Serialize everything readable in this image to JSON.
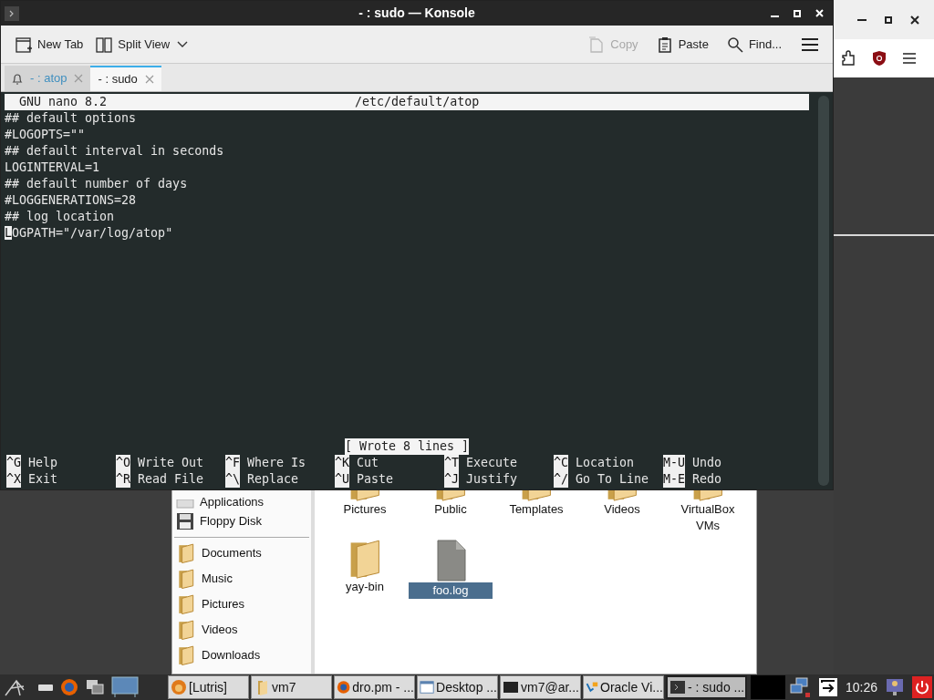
{
  "konsole": {
    "title": "- : sudo — Konsole",
    "toolbar_left": [
      {
        "label": "New Tab",
        "kind": "new-tab",
        "disabled": false
      },
      {
        "label": "Split View",
        "kind": "split-view",
        "disabled": false
      }
    ],
    "toolbar_right": [
      {
        "label": "Copy",
        "kind": "copy",
        "disabled": true
      },
      {
        "label": "Paste",
        "kind": "paste",
        "disabled": false
      },
      {
        "label": "Find...",
        "kind": "find",
        "disabled": false
      }
    ],
    "tabs": [
      {
        "label": "- : atop",
        "selected": false,
        "bell": true
      },
      {
        "label": "- : sudo",
        "selected": true,
        "bell": false
      }
    ],
    "nano": {
      "version": "GNU nano 8.2",
      "file": "/etc/default/atop",
      "lines": [
        {
          "text": "## default options",
          "cursor": false
        },
        {
          "text": "#LOGOPTS=\"\"",
          "cursor": false
        },
        {
          "text": "## default interval in seconds",
          "cursor": false
        },
        {
          "text": "LOGINTERVAL=1",
          "cursor": false
        },
        {
          "text": "## default number of days",
          "cursor": false
        },
        {
          "text": "#LOGGENERATIONS=28",
          "cursor": false
        },
        {
          "text": "## log location",
          "cursor": false
        },
        {
          "text": "LOGPATH=\"/var/log/atop\"",
          "cursor": true
        }
      ],
      "status": "[ Wrote 8 lines ]",
      "shortcuts": [
        [
          {
            "key": "^G",
            "label": "Help"
          },
          {
            "key": "^O",
            "label": "Write Out"
          },
          {
            "key": "^F",
            "label": "Where Is"
          },
          {
            "key": "^K",
            "label": "Cut"
          },
          {
            "key": "^T",
            "label": "Execute"
          },
          {
            "key": "^C",
            "label": "Location"
          },
          {
            "key": "M-U",
            "label": "Undo"
          }
        ],
        [
          {
            "key": "^X",
            "label": "Exit"
          },
          {
            "key": "^R",
            "label": "Read File"
          },
          {
            "key": "^\\",
            "label": "Replace"
          },
          {
            "key": "^U",
            "label": "Paste"
          },
          {
            "key": "^J",
            "label": "Justify"
          },
          {
            "key": "^/",
            "label": "Go To Line"
          },
          {
            "key": "M-E",
            "label": "Redo"
          }
        ]
      ]
    }
  },
  "file_manager": {
    "devices": [
      {
        "label": "Applications",
        "kind": "applications"
      },
      {
        "label": "Floppy Disk",
        "kind": "floppy"
      }
    ],
    "bookmarks": [
      {
        "label": "Documents"
      },
      {
        "label": "Music"
      },
      {
        "label": "Pictures"
      },
      {
        "label": "Videos"
      },
      {
        "label": "Downloads"
      }
    ],
    "files": [
      {
        "label": "Pictures",
        "kind": "folder",
        "selected": false
      },
      {
        "label": "Public",
        "kind": "folder",
        "selected": false
      },
      {
        "label": "Templates",
        "kind": "folder",
        "selected": false
      },
      {
        "label": "Videos",
        "kind": "folder",
        "selected": false
      },
      {
        "label": "VirtualBox VMs",
        "kind": "folder",
        "selected": false
      },
      {
        "label": "yay-bin",
        "kind": "folder",
        "selected": false
      },
      {
        "label": "foo.log",
        "kind": "file",
        "selected": true
      }
    ]
  },
  "taskbar": {
    "tasks": [
      {
        "label": "[Lutris]",
        "kind": "lutris",
        "selected": false
      },
      {
        "label": "vm7",
        "kind": "folder",
        "selected": false
      },
      {
        "label": "dro.pm - ...",
        "kind": "firefox",
        "selected": false
      },
      {
        "label": "Desktop ...",
        "kind": "window",
        "selected": false
      },
      {
        "label": "vm7@ar...",
        "kind": "terminal",
        "selected": false
      },
      {
        "label": "Oracle Vi...",
        "kind": "virtualbox",
        "selected": false
      },
      {
        "label": "- : sudo ...",
        "kind": "konsole",
        "selected": true
      }
    ],
    "clock": "10:26"
  }
}
